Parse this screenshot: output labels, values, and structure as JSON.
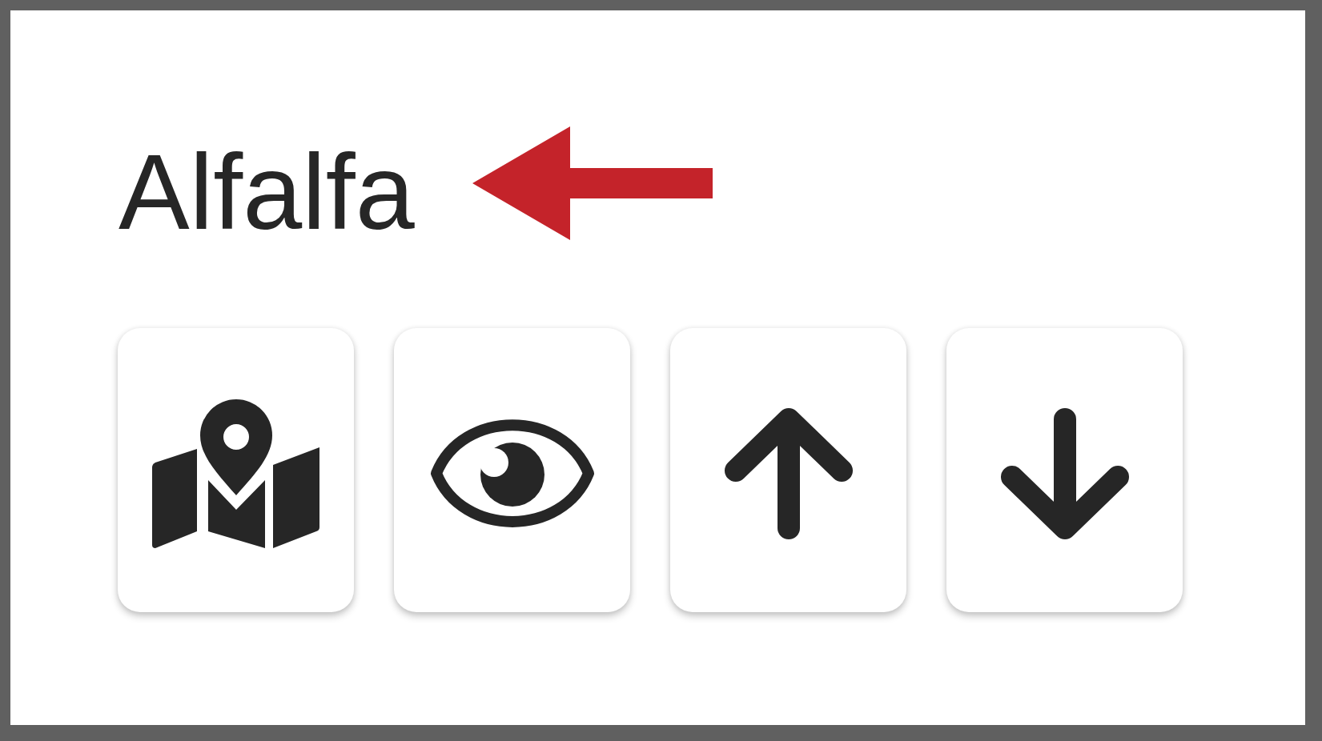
{
  "title": "Alfalfa",
  "buttons": [
    {
      "kind": "map"
    },
    {
      "kind": "view"
    },
    {
      "kind": "up"
    },
    {
      "kind": "down"
    }
  ]
}
